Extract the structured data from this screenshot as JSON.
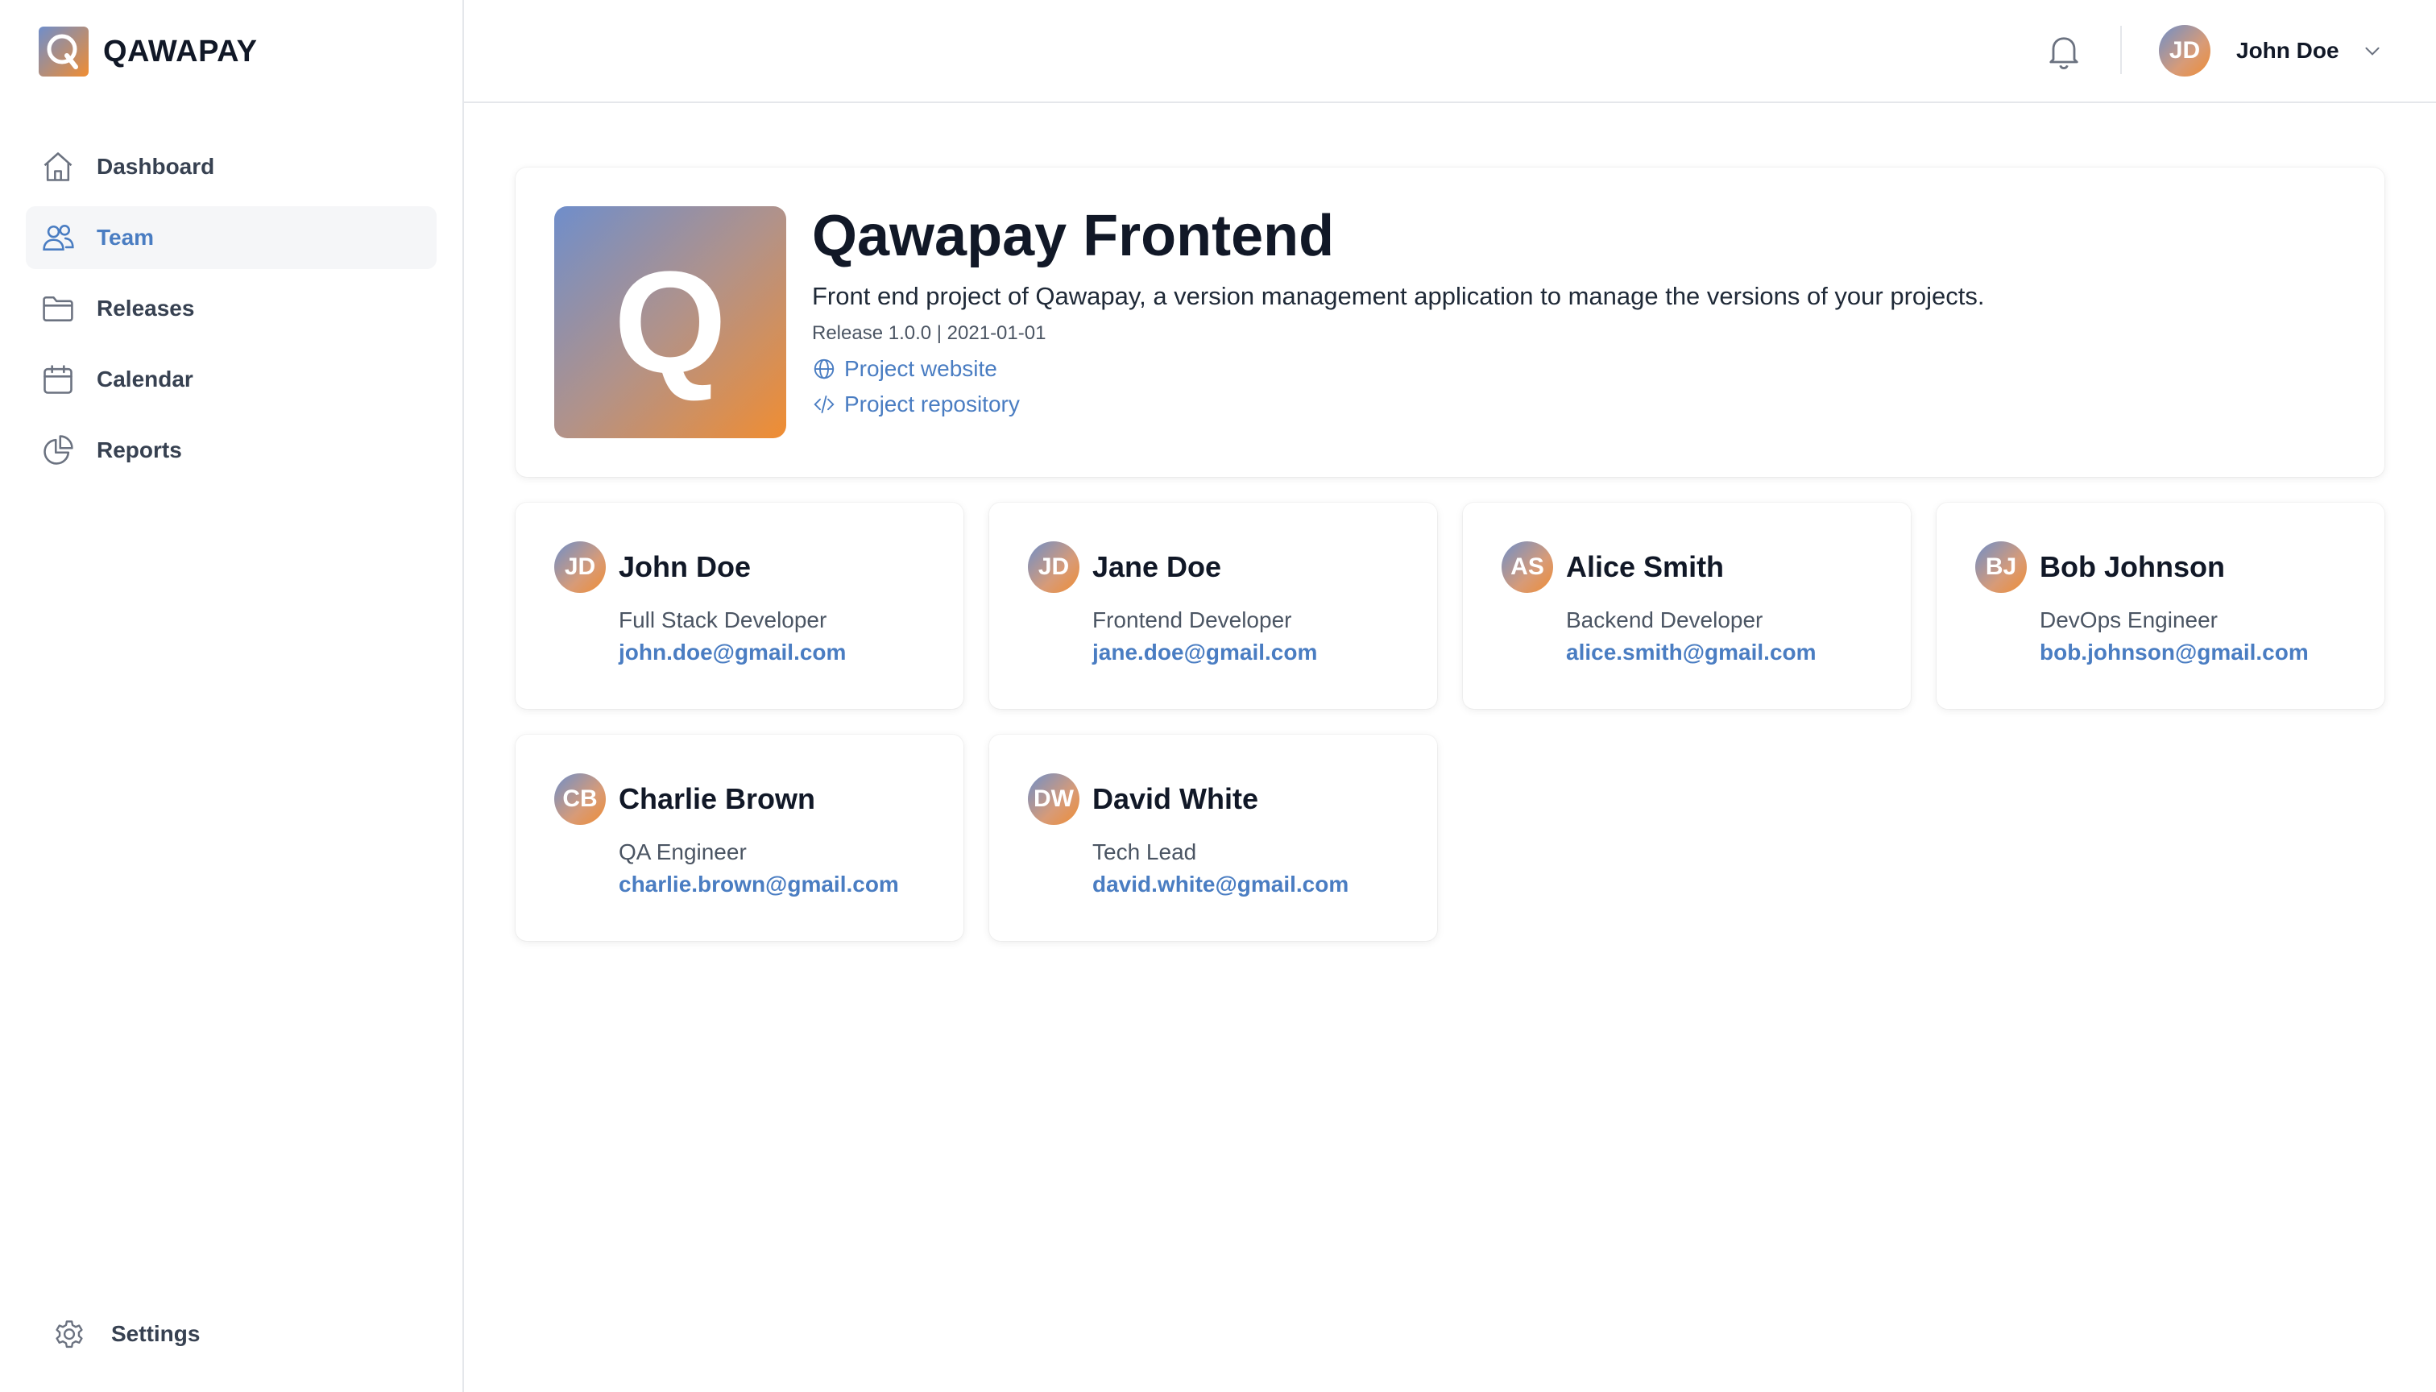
{
  "brand": {
    "name": "QAWAPAY"
  },
  "sidebar": {
    "items": [
      {
        "label": "Dashboard",
        "icon": "home-icon",
        "active": false
      },
      {
        "label": "Team",
        "icon": "users-icon",
        "active": true
      },
      {
        "label": "Releases",
        "icon": "folder-icon",
        "active": false
      },
      {
        "label": "Calendar",
        "icon": "calendar-icon",
        "active": false
      },
      {
        "label": "Reports",
        "icon": "pie-chart-icon",
        "active": false
      }
    ],
    "settings_label": "Settings"
  },
  "header": {
    "user": {
      "initials": "JD",
      "name": "John Doe"
    }
  },
  "project": {
    "logo_letter": "Q",
    "title": "Qawapay Frontend",
    "description": "Front end project of Qawapay, a version management application to manage the versions of your projects.",
    "meta": "Release 1.0.0 | 2021-01-01",
    "website_label": "Project website",
    "repository_label": "Project repository"
  },
  "team": [
    {
      "initials": "JD",
      "name": "John Doe",
      "role": "Full Stack Developer",
      "email": "john.doe@gmail.com"
    },
    {
      "initials": "JD",
      "name": "Jane Doe",
      "role": "Frontend Developer",
      "email": "jane.doe@gmail.com"
    },
    {
      "initials": "AS",
      "name": "Alice Smith",
      "role": "Backend Developer",
      "email": "alice.smith@gmail.com"
    },
    {
      "initials": "BJ",
      "name": "Bob Johnson",
      "role": "DevOps Engineer",
      "email": "bob.johnson@gmail.com"
    },
    {
      "initials": "CB",
      "name": "Charlie Brown",
      "role": "QA Engineer",
      "email": "charlie.brown@gmail.com"
    },
    {
      "initials": "DW",
      "name": "David White",
      "role": "Tech Lead",
      "email": "david.white@gmail.com"
    }
  ],
  "colors": {
    "accent": "#4a7dc2",
    "active_bg": "#f5f6f8",
    "gradient_start": "#6f8ecb",
    "gradient_end": "#f08d32"
  }
}
